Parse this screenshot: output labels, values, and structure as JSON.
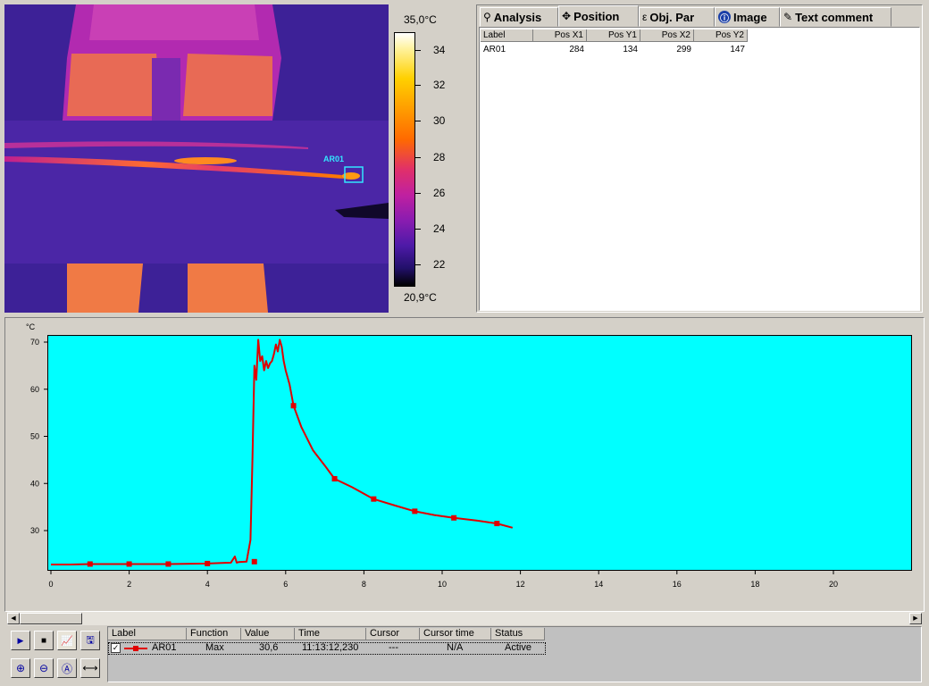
{
  "thermal_image": {
    "roi_label": "AR01"
  },
  "color_scale": {
    "max_label": "35,0°C",
    "min_label": "20,9°C",
    "ticks": [
      "34",
      "32",
      "30",
      "28",
      "26",
      "24",
      "22"
    ]
  },
  "tabs": [
    {
      "label": "Analysis",
      "icon": "analysis-icon"
    },
    {
      "label": "Position",
      "icon": "position-icon",
      "active": true
    },
    {
      "label": "Obj. Par",
      "icon": "object-parameters-icon"
    },
    {
      "label": "Image",
      "icon": "info-icon"
    },
    {
      "label": "Text comment",
      "icon": "text-comment-icon"
    }
  ],
  "position_table": {
    "columns": [
      "Label",
      "Pos X1",
      "Pos Y1",
      "Pos X2",
      "Pos Y2"
    ],
    "rows": [
      {
        "label": "AR01",
        "x1": "284",
        "y1": "134",
        "x2": "299",
        "y2": "147"
      }
    ]
  },
  "chart_data": {
    "type": "line",
    "ylabel": "°C",
    "xlim": [
      0,
      22
    ],
    "ylim": [
      22,
      71
    ],
    "x_ticks": [
      0,
      2,
      4,
      6,
      8,
      10,
      12,
      14,
      16,
      18,
      20
    ],
    "y_ticks": [
      30,
      40,
      50,
      60,
      70
    ],
    "background_color": "#00ffff",
    "series": [
      {
        "name": "AR01",
        "color": "#e00000",
        "x": [
          0,
          0.5,
          1,
          2,
          3,
          4,
          4.6,
          4.7,
          4.75,
          4.8,
          5.0,
          5.1,
          5.15,
          5.2,
          5.25,
          5.3,
          5.35,
          5.4,
          5.45,
          5.5,
          5.55,
          5.6,
          5.65,
          5.7,
          5.75,
          5.8,
          5.85,
          5.9,
          5.95,
          6.0,
          6.1,
          6.2,
          6.4,
          6.7,
          7.0,
          7.25,
          7.7,
          8.25,
          8.8,
          9.3,
          9.8,
          10.3,
          10.9,
          11.4,
          11.8
        ],
        "y": [
          22.8,
          22.8,
          22.9,
          22.9,
          22.9,
          23.0,
          23.2,
          24.5,
          23.2,
          23.3,
          23.4,
          28,
          45,
          65,
          62,
          70.5,
          66,
          67,
          64,
          66,
          64.5,
          65.5,
          66,
          67.5,
          69.5,
          68,
          70.5,
          69,
          66,
          64,
          61,
          56.5,
          52,
          47,
          43.8,
          41.0,
          39.2,
          36.7,
          35.3,
          34.1,
          33.3,
          32.7,
          32.1,
          31.5,
          30.6
        ],
        "markers_x": [
          1,
          2,
          3,
          4,
          5.2,
          6.2,
          7.25,
          8.25,
          9.3,
          10.3,
          11.4
        ],
        "markers_y": [
          22.9,
          22.9,
          22.9,
          23.0,
          23.4,
          56.5,
          41.0,
          36.7,
          34.1,
          32.7,
          31.5
        ]
      }
    ]
  },
  "legend_table": {
    "columns": [
      "Label",
      "Function",
      "Value",
      "Time",
      "Cursor",
      "Cursor time",
      "Status"
    ],
    "rows": [
      {
        "checked": "✓",
        "label": "AR01",
        "function": "Max",
        "value": "30,6",
        "time": "11:13:12,230",
        "cursor": "---",
        "cursor_time": "N/A",
        "status": "Active"
      }
    ]
  },
  "toolbar": {
    "buttons": [
      "play-icon",
      "stop-icon",
      "chart-settings-icon",
      "chart-export-icon",
      "zoom-in-icon",
      "zoom-out-icon",
      "zoom-reset-icon",
      "fit-width-icon"
    ]
  }
}
